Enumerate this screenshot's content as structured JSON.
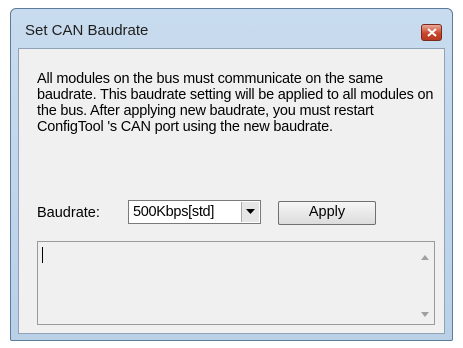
{
  "window": {
    "title": "Set CAN Baudrate",
    "close_icon": "close-icon"
  },
  "message": "All modules on the bus must communicate on the same baudrate. This baudrate setting will be applied to all modules on the bus. After applying new baudrate, you must restart ConfigTool 's CAN port using the new baudrate.",
  "baudrate": {
    "label": "Baudrate:",
    "selected": "500Kbps[std]"
  },
  "apply_label": "Apply",
  "log": {
    "value": ""
  }
}
